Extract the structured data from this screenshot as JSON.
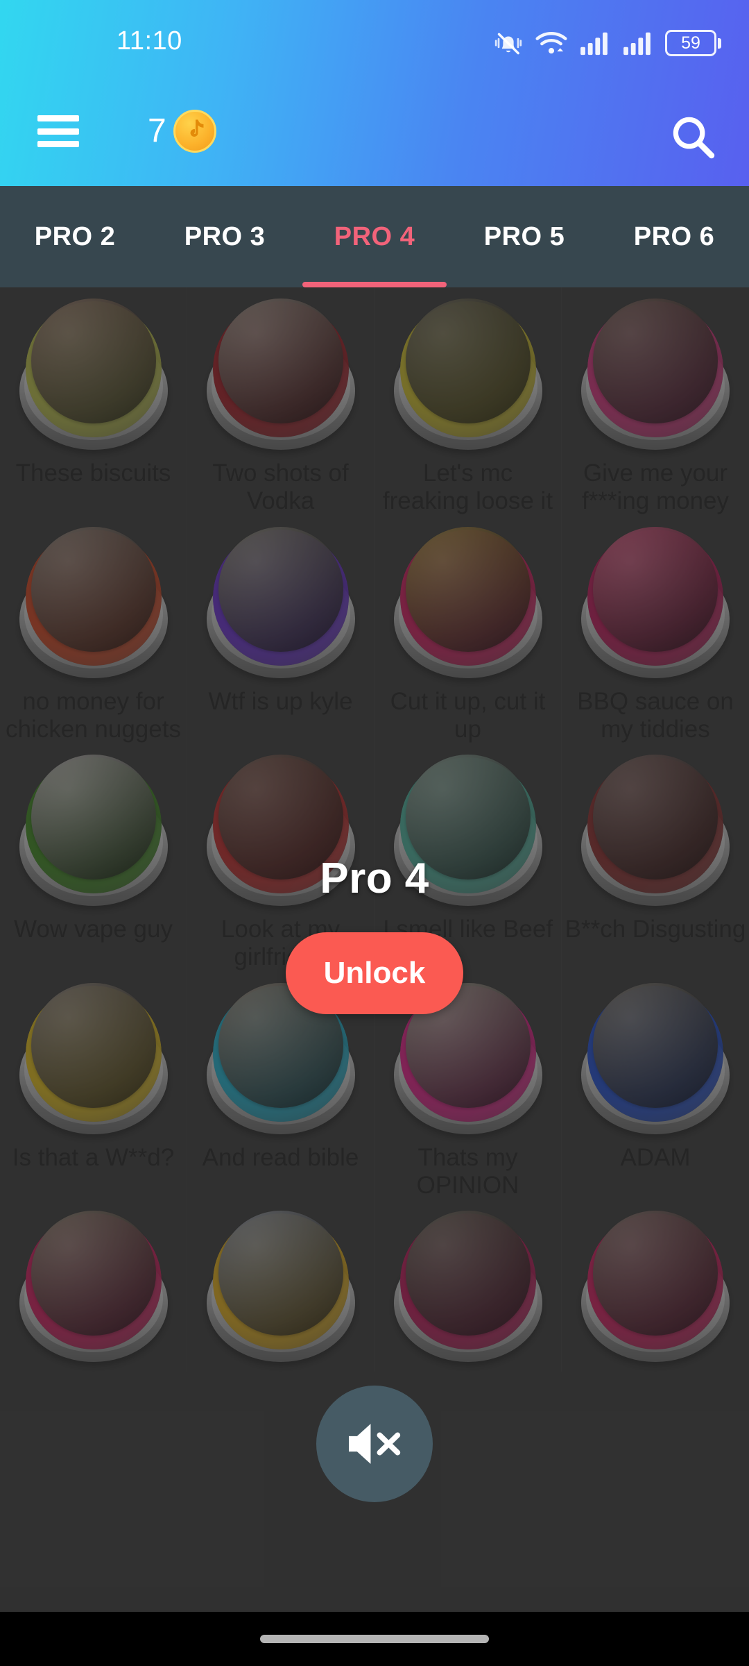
{
  "status_bar": {
    "time": "11:10",
    "battery_level": "59",
    "icons": [
      "bell-mute-icon",
      "wifi-icon",
      "signal-icon",
      "signal-icon",
      "battery-icon"
    ]
  },
  "app_bar": {
    "menu_icon": "hamburger-menu-icon",
    "coin_count": "7",
    "coin_icon": "tiktok-coin-icon",
    "search_icon": "search-icon"
  },
  "tabs": [
    {
      "label": "PRO 2",
      "active": false
    },
    {
      "label": "PRO 3",
      "active": false
    },
    {
      "label": "PRO 4",
      "active": true
    },
    {
      "label": "PRO 5",
      "active": false
    },
    {
      "label": "PRO 6",
      "active": false
    }
  ],
  "colors": {
    "header_gradient_start": "#32D7F0",
    "header_gradient_end": "#5860EF",
    "tabbar_background": "#37474F",
    "tab_active": "#F2637A",
    "unlock_button": "#FB5A52",
    "content_background": "#3B3B3B",
    "coin": "#FCB22B",
    "fab_background": "#4C6572"
  },
  "unlock_overlay": {
    "title": "Pro 4",
    "button_label": "Unlock"
  },
  "mute_fab": {
    "icon": "volume-mute-icon",
    "label": "Mute"
  },
  "sound_buttons": [
    {
      "label": "These biscuits",
      "color": "#BFC44A",
      "photo": "#8E6C52"
    },
    {
      "label": "Two shots of Vodka",
      "color": "#A81B24",
      "photo": "#9B8174"
    },
    {
      "label": "Let's mc freaking loose it",
      "color": "#D4C32B",
      "photo": "#5D5639"
    },
    {
      "label": "Give me your f***ing money",
      "color": "#D9327E",
      "photo": "#6E4B41"
    },
    {
      "label": "no money for chicken nuggets",
      "color": "#D8441E",
      "photo": "#8A7364"
    },
    {
      "label": "Wtf is up kyle",
      "color": "#6A2ED6",
      "photo": "#7C766C"
    },
    {
      "label": "Cut it up, cut it up",
      "color": "#D81B60",
      "photo": "#A5761C"
    },
    {
      "label": "BBQ sauce on my tiddies",
      "color": "#C2185B",
      "photo": "#E03A6D"
    },
    {
      "label": "Wow vape guy",
      "color": "#3E8C1E",
      "photo": "#BFBCB4"
    },
    {
      "label": "Look at my girlfriend",
      "color": "#C62828",
      "photo": "#6E4436"
    },
    {
      "label": "I smell like Beef",
      "color": "#4DB6A0",
      "photo": "#7D9B8C"
    },
    {
      "label": "B**ch Disgusting",
      "color": "#8E2A2A",
      "photo": "#6B4A45"
    },
    {
      "label": "Is that a W**d?",
      "color": "#E8C21A",
      "photo": "#877866"
    },
    {
      "label": "And read bible",
      "color": "#1FB6D4",
      "photo": "#8A8272"
    },
    {
      "label": "Thats my OPINION",
      "color": "#E91E8C",
      "photo": "#A59587"
    },
    {
      "label": "ADAM",
      "color": "#1F4FD8",
      "photo": "#6A645D"
    },
    {
      "label": "",
      "color": "#D81B60",
      "photo": "#87705D"
    },
    {
      "label": "",
      "color": "#E8B21A",
      "photo": "#8B9099"
    },
    {
      "label": "",
      "color": "#C2185B",
      "photo": "#5E5043"
    },
    {
      "label": "",
      "color": "#D81B60",
      "photo": "#7E5B55"
    }
  ],
  "bottom_nav": {
    "gesture_pill": "gesture-pill"
  }
}
